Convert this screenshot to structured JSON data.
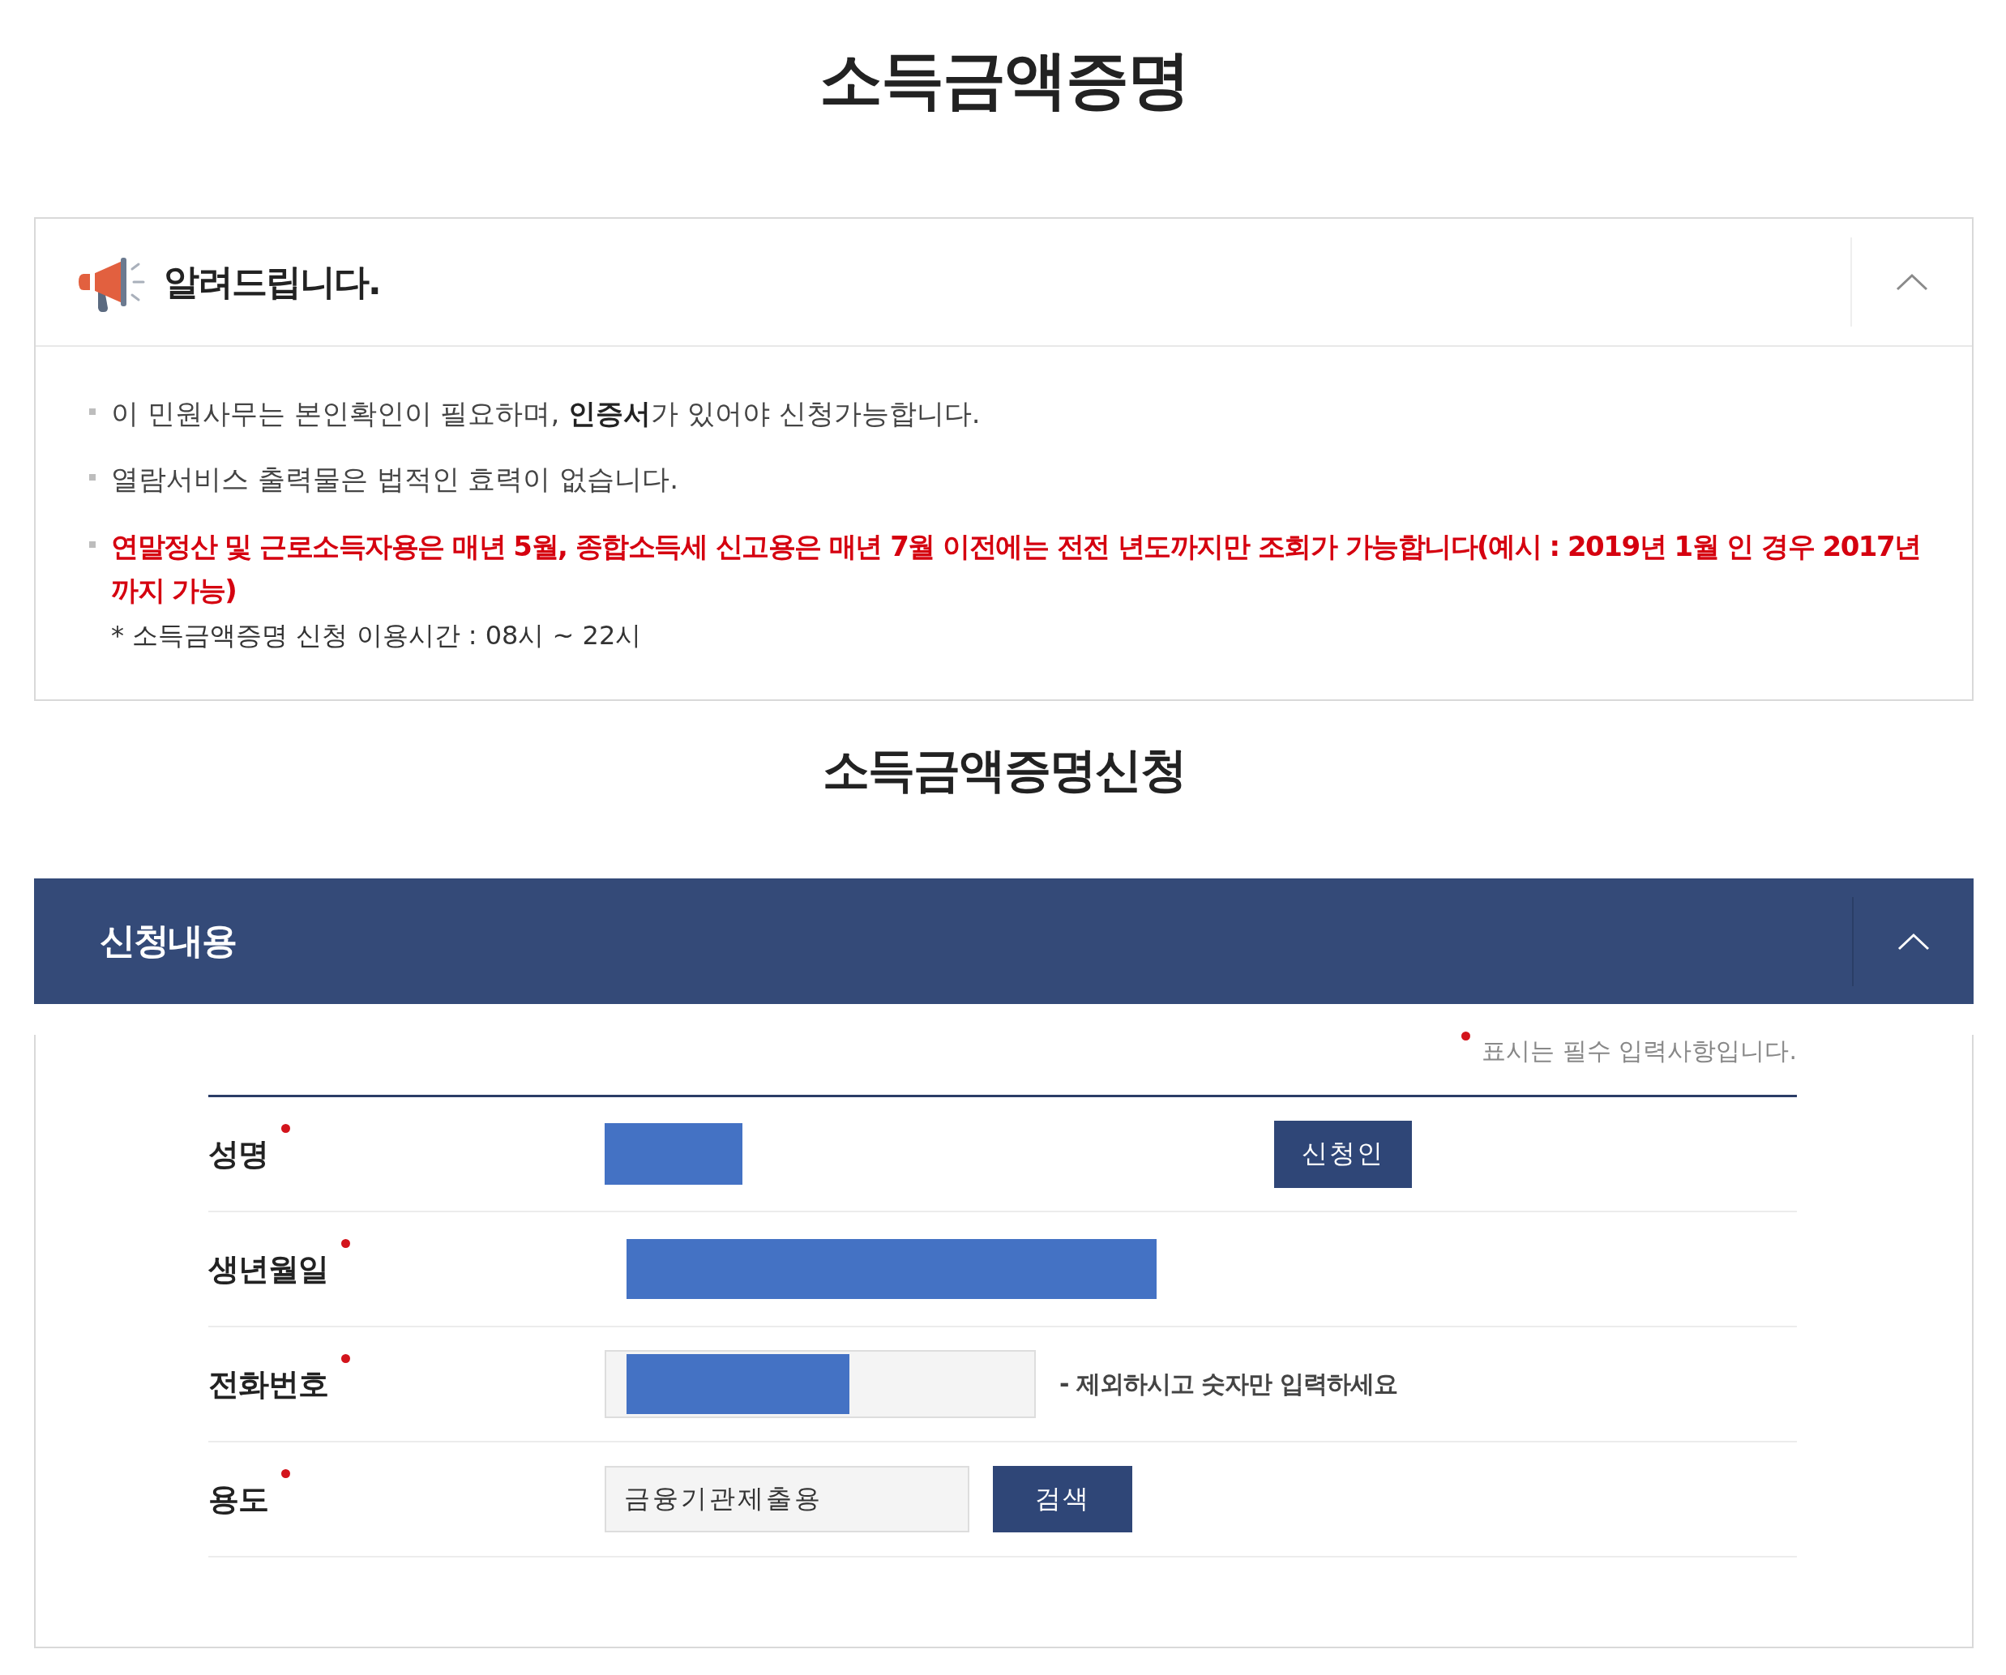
{
  "page_title": "소득금액증명",
  "notice": {
    "title": "알려드립니다.",
    "expanded": true,
    "items": [
      "이 민원사무는 본인확인이 필요하며, **인증서**가 있어야 신청가능합니다.",
      "열람서비스 출력물은 법적인 효력이 없습니다."
    ],
    "warning": "연말정산 및 근로소득자용은 매년 5월, 종합소득세 신고용은 매년 7월 이전에는 전전 년도까지만 조회가 가능합니다(예시 : 2019년 1월 인 경우 2017년까지 가능)",
    "note": "* 소득금액증명 신청 이용시간 : 08시 ~ 22시"
  },
  "section_title": "소득금액증명신청",
  "panel": {
    "title": "신청내용",
    "expanded": true,
    "required_note": "표시는 필수 입력사항입니다.",
    "rows": [
      {
        "label": "성명",
        "required": true,
        "kind": "text",
        "redacted": true,
        "button": "신청인"
      },
      {
        "label": "생년월일",
        "required": true,
        "kind": "text",
        "redacted": true
      },
      {
        "label": "전화번호",
        "required": true,
        "kind": "input",
        "redacted": true,
        "hint": "- 제외하시고 숫자만 입력하세요"
      },
      {
        "label": "용도",
        "required": true,
        "kind": "select",
        "value": "금융기관제출용",
        "button": "검색"
      }
    ]
  }
}
